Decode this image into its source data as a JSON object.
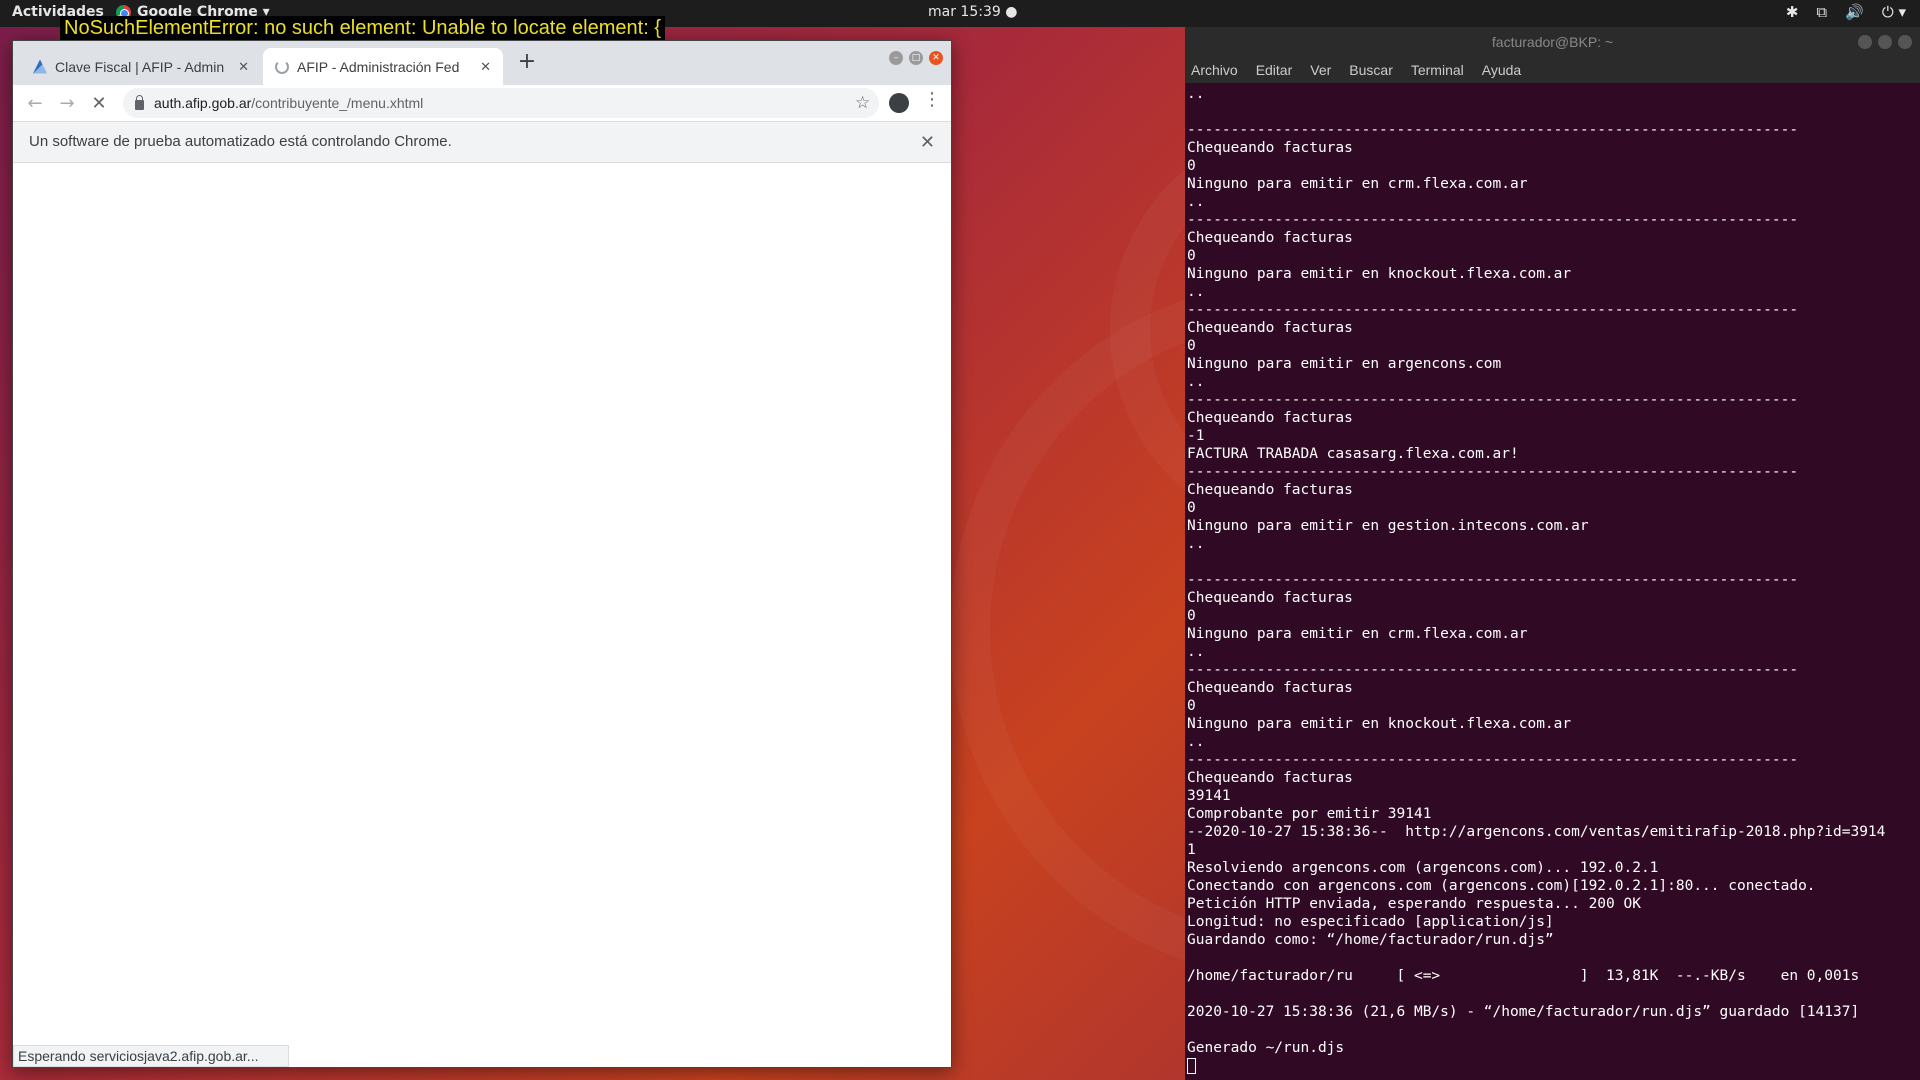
{
  "top_panel": {
    "activities": "Actividades",
    "app_name": "Google Chrome ▾",
    "clock": "mar 15:39 ●",
    "tray_icons": [
      "bluetooth-icon",
      "network-icon",
      "volume-icon",
      "power-icon"
    ]
  },
  "error_banner": "NoSuchElementError: no such element: Unable to locate element: {",
  "chrome": {
    "tabs": [
      {
        "title": "Clave Fiscal | AFIP - Admin",
        "close": "✕"
      },
      {
        "title": "AFIP - Administración Fed",
        "close": "✕"
      }
    ],
    "new_tab": "+",
    "url_host": "auth.afip.gob.ar",
    "url_path": "/contribuyente_/menu.xhtml",
    "infobar_text": "Un software de prueba automatizado está controlando Chrome.",
    "infobar_close": "✕",
    "status_text": "Esperando serviciosjava2.afip.gob.ar..."
  },
  "terminal": {
    "title": "facturador@BKP: ~",
    "menu": [
      "Archivo",
      "Editar",
      "Ver",
      "Buscar",
      "Terminal",
      "Ayuda"
    ],
    "lines": [
      "..",
      "",
      "----------------------------------------------------------------------",
      "Chequeando facturas",
      "0",
      "Ninguno para emitir en crm.flexa.com.ar",
      "..",
      "----------------------------------------------------------------------",
      "Chequeando facturas",
      "0",
      "Ninguno para emitir en knockout.flexa.com.ar",
      "..",
      "----------------------------------------------------------------------",
      "Chequeando facturas",
      "0",
      "Ninguno para emitir en argencons.com",
      "..",
      "----------------------------------------------------------------------",
      "Chequeando facturas",
      "-1",
      "FACTURA TRABADA casasarg.flexa.com.ar!",
      "----------------------------------------------------------------------",
      "Chequeando facturas",
      "0",
      "Ninguno para emitir en gestion.intecons.com.ar",
      "..",
      "",
      "----------------------------------------------------------------------",
      "Chequeando facturas",
      "0",
      "Ninguno para emitir en crm.flexa.com.ar",
      "..",
      "----------------------------------------------------------------------",
      "Chequeando facturas",
      "0",
      "Ninguno para emitir en knockout.flexa.com.ar",
      "..",
      "----------------------------------------------------------------------",
      "Chequeando facturas",
      "39141",
      "Comprobante por emitir 39141",
      "--2020-10-27 15:38:36--  http://argencons.com/ventas/emitirafip-2018.php?id=3914",
      "1",
      "Resolviendo argencons.com (argencons.com)... 192.0.2.1",
      "Conectando con argencons.com (argencons.com)[192.0.2.1]:80... conectado.",
      "Petición HTTP enviada, esperando respuesta... 200 OK",
      "Longitud: no especificado [application/js]",
      "Guardando como: “/home/facturador/run.djs”",
      "",
      "/home/facturador/ru     [ <=>                ]  13,81K  --.-KB/s    en 0,001s",
      "",
      "2020-10-27 15:38:36 (21,6 MB/s) - “/home/facturador/run.djs” guardado [14137]",
      "",
      "Generado ~/run.djs"
    ]
  }
}
